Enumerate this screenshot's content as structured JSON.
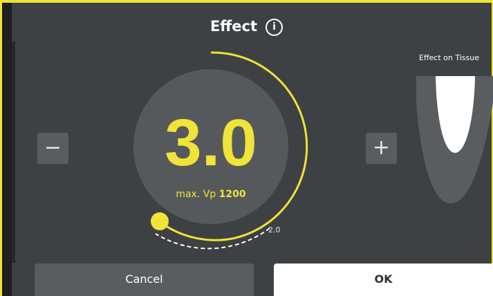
{
  "dialog": {
    "title": "Effect",
    "info_icon": "info-icon",
    "info_glyph": "i"
  },
  "controls": {
    "minus_label": "−",
    "plus_label": "+"
  },
  "gauge": {
    "value": "3.0",
    "max_vp_prefix": "max. Vp",
    "max_vp_value": "1200",
    "tick_label": "2.0",
    "accent_color": "#f0e33a",
    "level": 0.75
  },
  "tissue": {
    "title": "Effect on Tissue"
  },
  "actions": {
    "cancel_label": "Cancel",
    "ok_label": "OK"
  }
}
